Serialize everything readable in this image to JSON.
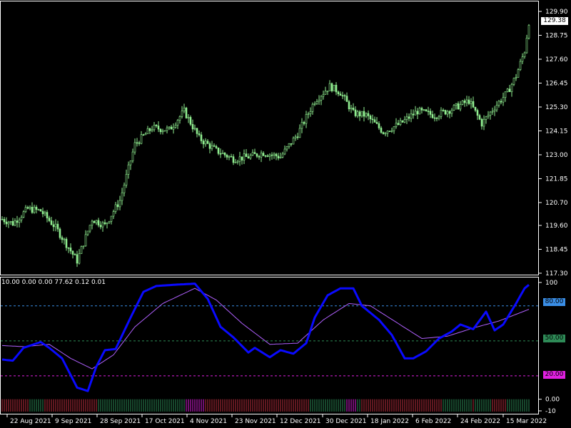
{
  "colors": {
    "background": "#000000",
    "candle": "#90ee90",
    "stoch_main": "#0a0aff",
    "stoch_signal": "#b060ff",
    "level_80": "#3a8ee6",
    "level_50": "#2e8b57",
    "level_20": "#e020e0",
    "grid": "#ffffff"
  },
  "price_axis": {
    "ticks": [
      "129.90",
      "128.75",
      "127.60",
      "126.45",
      "125.30",
      "124.15",
      "123.00",
      "121.85",
      "120.70",
      "119.60",
      "118.45",
      "117.30"
    ],
    "current_price": "129.38",
    "range": [
      117.3,
      129.9
    ]
  },
  "indicator": {
    "header": "10.00 0.00 0.00 77.62 0.12 0.01",
    "axis_ticks": [
      "100",
      "0.00",
      "-10"
    ],
    "levels": [
      {
        "label": "80.00",
        "value": 80
      },
      {
        "label": "50.00",
        "value": 50
      },
      {
        "label": "20.00",
        "value": 20
      }
    ]
  },
  "time_axis": {
    "labels": [
      "22 Aug 2021",
      "9 Sep 2021",
      "28 Sep 2021",
      "17 Oct 2021",
      "4 Nov 2021",
      "23 Nov 2021",
      "12 Dec 2021",
      "30 Dec 2021",
      "18 Jan 2022",
      "6 Feb 2022",
      "24 Feb 2022",
      "15 Mar 2022"
    ]
  },
  "chart_data": {
    "type": "candlestick",
    "price_keypoints": [
      {
        "i": 0,
        "v": 119.9
      },
      {
        "i": 5,
        "v": 119.7
      },
      {
        "i": 12,
        "v": 120.4
      },
      {
        "i": 18,
        "v": 120.3
      },
      {
        "i": 25,
        "v": 119.5
      },
      {
        "i": 35,
        "v": 117.9
      },
      {
        "i": 42,
        "v": 119.9
      },
      {
        "i": 48,
        "v": 119.6
      },
      {
        "i": 55,
        "v": 120.8
      },
      {
        "i": 62,
        "v": 123.5
      },
      {
        "i": 70,
        "v": 124.3
      },
      {
        "i": 78,
        "v": 124.2
      },
      {
        "i": 85,
        "v": 125.1
      },
      {
        "i": 92,
        "v": 123.8
      },
      {
        "i": 100,
        "v": 123.2
      },
      {
        "i": 108,
        "v": 122.8
      },
      {
        "i": 115,
        "v": 122.9
      },
      {
        "i": 122,
        "v": 123.1
      },
      {
        "i": 130,
        "v": 122.9
      },
      {
        "i": 138,
        "v": 124.0
      },
      {
        "i": 146,
        "v": 125.6
      },
      {
        "i": 153,
        "v": 126.3
      },
      {
        "i": 158,
        "v": 126.0
      },
      {
        "i": 164,
        "v": 125.0
      },
      {
        "i": 170,
        "v": 124.9
      },
      {
        "i": 178,
        "v": 124.1
      },
      {
        "i": 186,
        "v": 124.5
      },
      {
        "i": 194,
        "v": 125.1
      },
      {
        "i": 202,
        "v": 124.9
      },
      {
        "i": 210,
        "v": 125.2
      },
      {
        "i": 218,
        "v": 125.6
      },
      {
        "i": 224,
        "v": 124.5
      },
      {
        "i": 230,
        "v": 125.3
      },
      {
        "i": 236,
        "v": 126.0
      },
      {
        "i": 240,
        "v": 126.8
      },
      {
        "i": 244,
        "v": 128.0
      },
      {
        "i": 246,
        "v": 129.4
      }
    ],
    "stoch_main_keypoints": [
      {
        "i": 0,
        "v": 34
      },
      {
        "i": 5,
        "v": 33
      },
      {
        "i": 10,
        "v": 44
      },
      {
        "i": 18,
        "v": 49
      },
      {
        "i": 22,
        "v": 44
      },
      {
        "i": 28,
        "v": 35
      },
      {
        "i": 35,
        "v": 10
      },
      {
        "i": 40,
        "v": 7
      },
      {
        "i": 44,
        "v": 28
      },
      {
        "i": 48,
        "v": 42
      },
      {
        "i": 53,
        "v": 43
      },
      {
        "i": 60,
        "v": 70
      },
      {
        "i": 66,
        "v": 92
      },
      {
        "i": 72,
        "v": 97
      },
      {
        "i": 80,
        "v": 98
      },
      {
        "i": 90,
        "v": 99
      },
      {
        "i": 96,
        "v": 86
      },
      {
        "i": 102,
        "v": 62
      },
      {
        "i": 108,
        "v": 53
      },
      {
        "i": 115,
        "v": 40
      },
      {
        "i": 118,
        "v": 44
      },
      {
        "i": 125,
        "v": 36
      },
      {
        "i": 130,
        "v": 42
      },
      {
        "i": 136,
        "v": 39
      },
      {
        "i": 142,
        "v": 48
      },
      {
        "i": 146,
        "v": 70
      },
      {
        "i": 152,
        "v": 89
      },
      {
        "i": 158,
        "v": 95
      },
      {
        "i": 164,
        "v": 95
      },
      {
        "i": 168,
        "v": 80
      },
      {
        "i": 176,
        "v": 68
      },
      {
        "i": 182,
        "v": 55
      },
      {
        "i": 188,
        "v": 35
      },
      {
        "i": 192,
        "v": 35
      },
      {
        "i": 198,
        "v": 41
      },
      {
        "i": 204,
        "v": 52
      },
      {
        "i": 210,
        "v": 58
      },
      {
        "i": 214,
        "v": 64
      },
      {
        "i": 220,
        "v": 60
      },
      {
        "i": 226,
        "v": 75
      },
      {
        "i": 230,
        "v": 59
      },
      {
        "i": 234,
        "v": 64
      },
      {
        "i": 240,
        "v": 82
      },
      {
        "i": 244,
        "v": 95
      },
      {
        "i": 246,
        "v": 98
      }
    ],
    "stoch_signal_keypoints": [
      {
        "i": 0,
        "v": 46
      },
      {
        "i": 10,
        "v": 45
      },
      {
        "i": 22,
        "v": 47
      },
      {
        "i": 32,
        "v": 35
      },
      {
        "i": 42,
        "v": 26
      },
      {
        "i": 52,
        "v": 38
      },
      {
        "i": 62,
        "v": 62
      },
      {
        "i": 75,
        "v": 82
      },
      {
        "i": 90,
        "v": 95
      },
      {
        "i": 100,
        "v": 85
      },
      {
        "i": 112,
        "v": 65
      },
      {
        "i": 125,
        "v": 47
      },
      {
        "i": 138,
        "v": 48
      },
      {
        "i": 150,
        "v": 68
      },
      {
        "i": 162,
        "v": 82
      },
      {
        "i": 172,
        "v": 80
      },
      {
        "i": 184,
        "v": 66
      },
      {
        "i": 196,
        "v": 52
      },
      {
        "i": 208,
        "v": 54
      },
      {
        "i": 220,
        "v": 61
      },
      {
        "i": 232,
        "v": 67
      },
      {
        "i": 246,
        "v": 77
      }
    ],
    "bar_count": 247
  }
}
